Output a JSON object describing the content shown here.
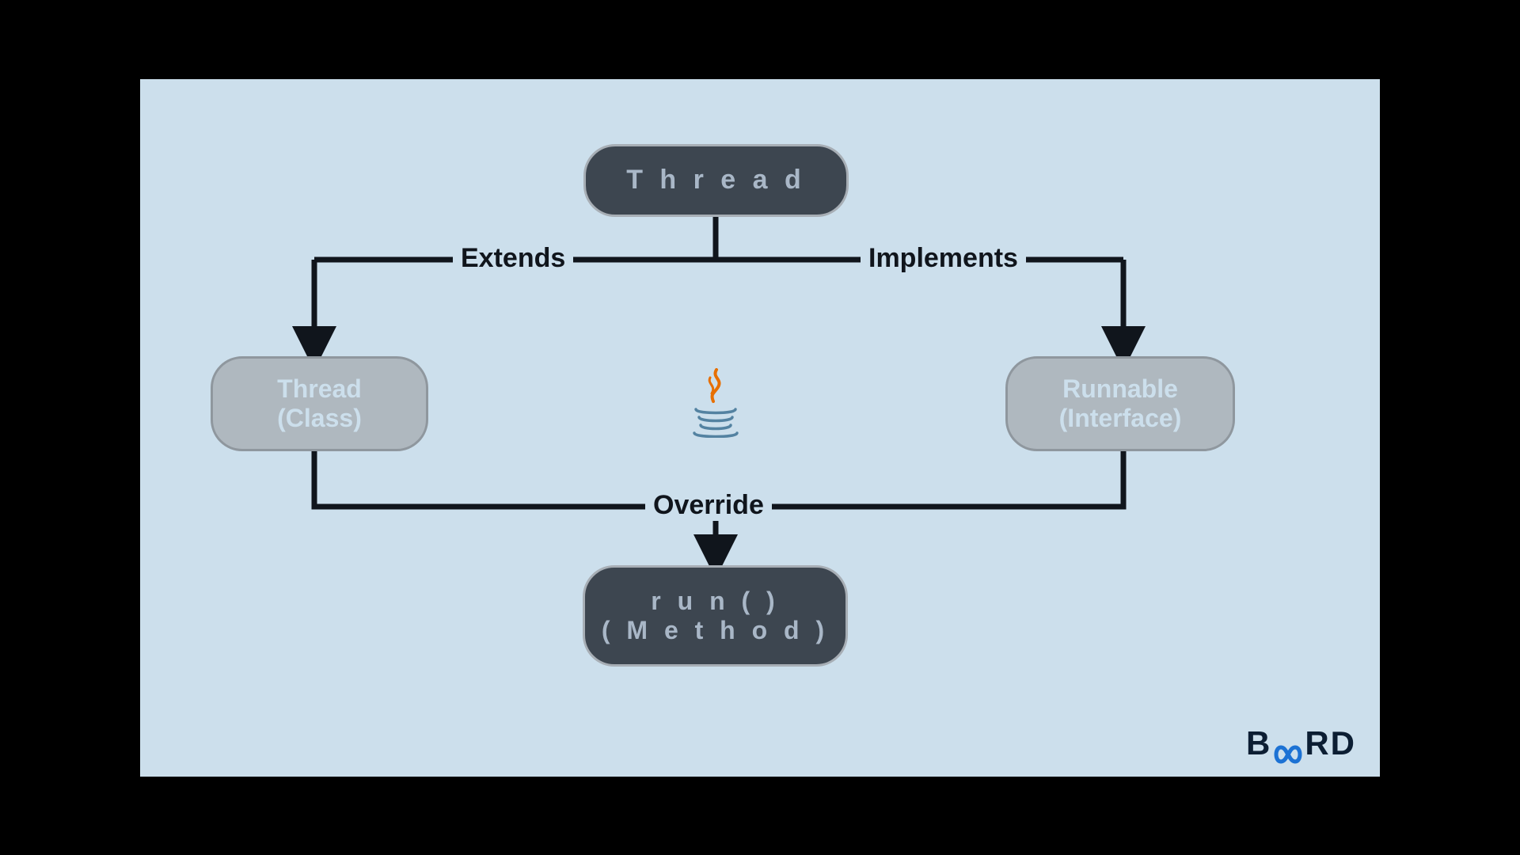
{
  "nodes": {
    "top": {
      "line1": "T h r e a d"
    },
    "left": {
      "line1": "Thread",
      "line2": "(Class)"
    },
    "right": {
      "line1": "Runnable",
      "line2": "(Interface)"
    },
    "bottom": {
      "line1": "r u n ( )",
      "line2": "( M e t h o d )"
    }
  },
  "edges": {
    "extends": "Extends",
    "implements": "Implements",
    "override": "Override"
  },
  "brand": {
    "pre": "B",
    "post": "RD"
  },
  "icons": {
    "java": "java-icon",
    "infinity": "infinity-icon"
  }
}
